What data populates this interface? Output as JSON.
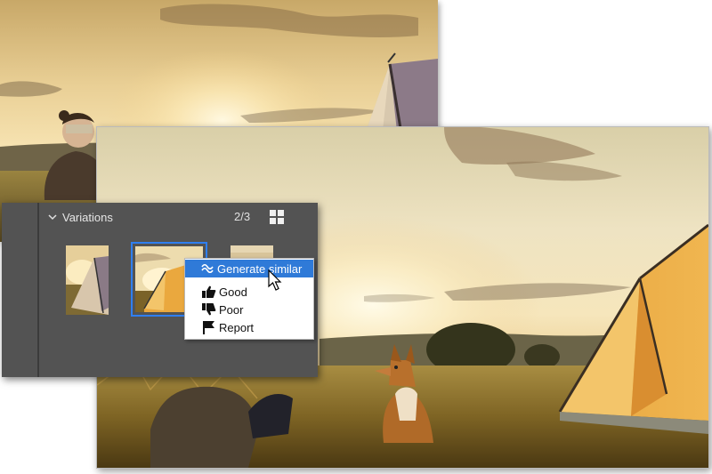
{
  "panel": {
    "title": "Variations",
    "count": "2/3",
    "grid_icon": "grid-view-icon",
    "collapse_icon": "chevron-down-icon"
  },
  "menu": {
    "items": [
      {
        "label": "Generate similar",
        "icon": "approx-icon",
        "highlighted": true
      },
      {
        "label": "Good",
        "icon": "thumbs-up-icon"
      },
      {
        "label": "Poor",
        "icon": "thumbs-down-icon"
      },
      {
        "label": "Report",
        "icon": "flag-icon"
      }
    ]
  },
  "colors": {
    "panel_bg": "#535353",
    "selection": "#2f7ff0",
    "menu_highlight": "#2f7ad8"
  }
}
